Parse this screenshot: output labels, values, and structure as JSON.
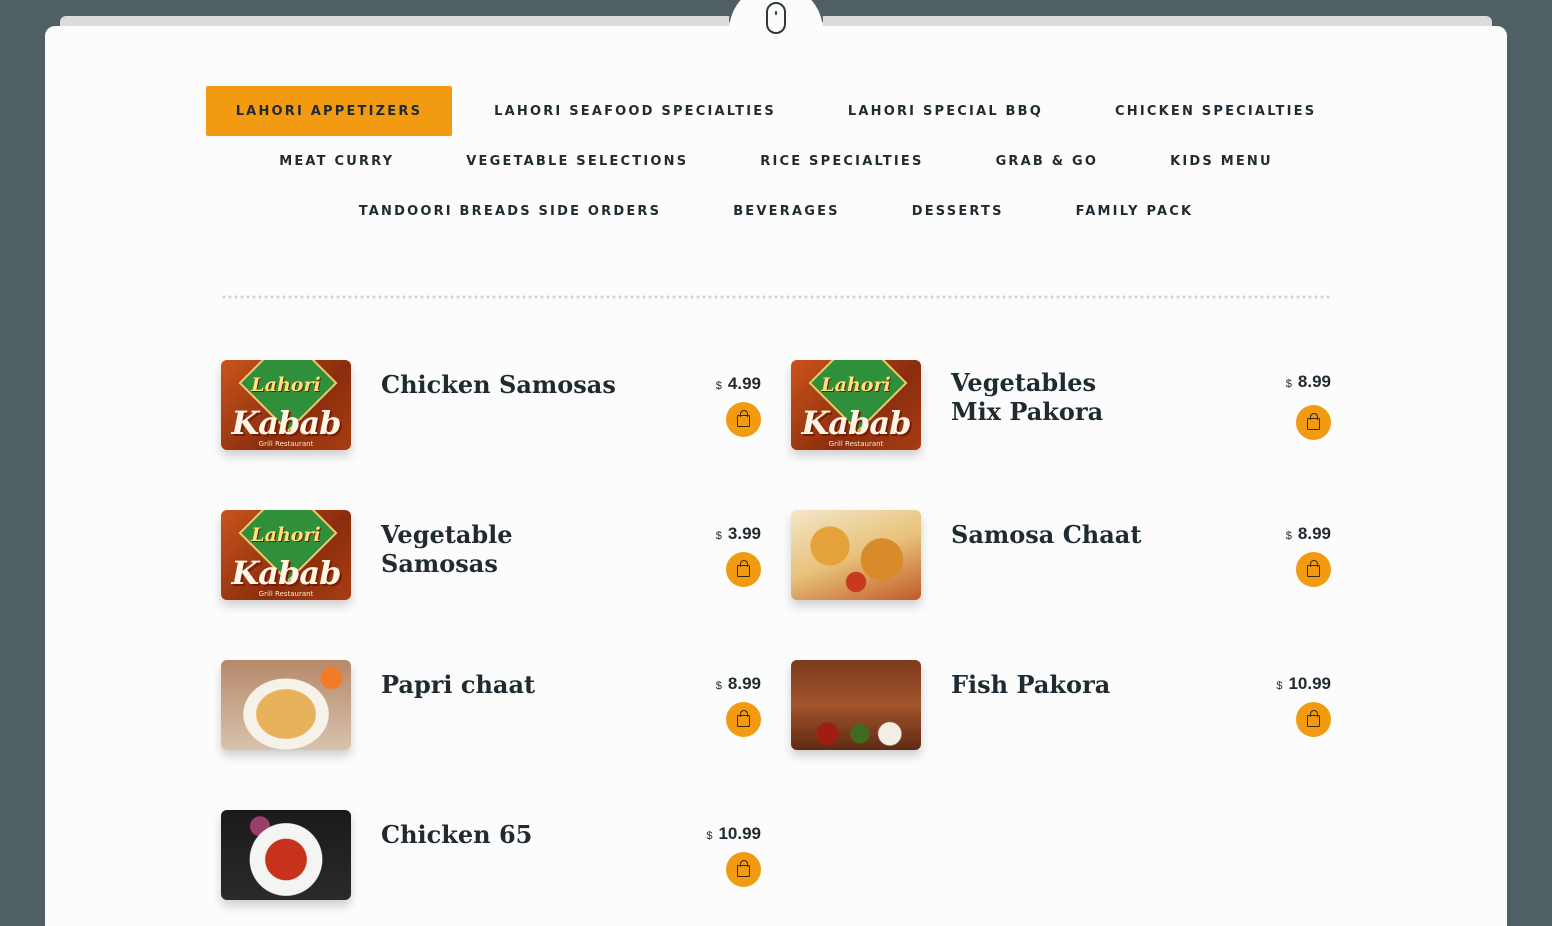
{
  "header": {
    "mouse_icon": "mouse-scroll-icon"
  },
  "tabs": {
    "rows": [
      [
        "LAHORI APPETIZERS",
        "LAHORI SEAFOOD SPECIALTIES",
        "LAHORI SPECIAL BBQ",
        "CHICKEN SPECIALTIES"
      ],
      [
        "MEAT CURRY",
        "VEGETABLE SELECTIONS",
        "RICE SPECIALTIES",
        "GRAB & GO",
        "KIDS MENU"
      ],
      [
        "TANDOORI BREADS SIDE ORDERS",
        "BEVERAGES",
        "DESSERTS",
        "FAMILY PACK"
      ]
    ],
    "active": "LAHORI APPETIZERS"
  },
  "logo": {
    "line1": "Lahori",
    "line2": "Kabab",
    "line3": "Grill Restaurant"
  },
  "currency": "$",
  "colors": {
    "accent": "#f29b12",
    "page_bg": "#505f63",
    "card_bg": "#fcfcfc",
    "text": "#1f2b30"
  },
  "items": [
    {
      "name": "Chicken Samosas",
      "price": "4.99",
      "image": "logo"
    },
    {
      "name": "Vegetables Mix Pakora",
      "price": "8.99",
      "image": "logo"
    },
    {
      "name": "Vegetable Samosas",
      "price": "3.99",
      "image": "logo"
    },
    {
      "name": "Samosa Chaat",
      "price": "8.99",
      "image": "samosa-chaat-photo"
    },
    {
      "name": "Papri chaat",
      "price": "8.99",
      "image": "papri-chaat-photo"
    },
    {
      "name": "Fish Pakora",
      "price": "10.99",
      "image": "fish-pakora-photo"
    },
    {
      "name": "Chicken 65",
      "price": "10.99",
      "image": "chicken-65-photo"
    }
  ],
  "cart_icon": "shopping-bag-icon"
}
